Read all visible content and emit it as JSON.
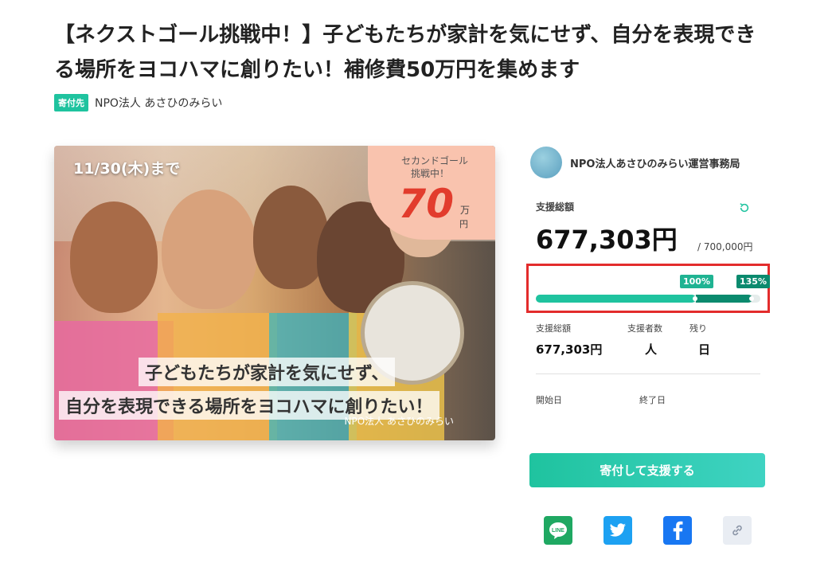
{
  "project": {
    "title": "【ネクストゴール挑戦中！】子どもたちが家計を気にせず、自分を表現できる場所をヨコハマに創りたい！補修費50万円を集めます",
    "recipient_tag": "寄付先",
    "recipient_name": "NPO法人 あさひのみらい"
  },
  "hero": {
    "deadline": "11/30(木)まで",
    "badge_line1": "セカンドゴール",
    "badge_line2": "挑戦中！",
    "badge_number": "70",
    "badge_unit1": "万",
    "badge_unit2": "円",
    "caption_line1": "子どもたちが家計を気にせず、",
    "caption_line2": "自分を表現できる場所をヨコハマに創りたい！",
    "org": "NPO法人 あさひのみらい"
  },
  "sidebar": {
    "org_name": "NPO法人あさひのみらい運営事務局",
    "total_label": "支援総額",
    "total_amount": "677,303円",
    "goal_amount": "/ 700,000円",
    "progress": {
      "first_goal_percent": 100,
      "current_percent": 135,
      "first_label": "100%",
      "current_label": "135%"
    },
    "stats": [
      {
        "label": "支援総額",
        "value": "677,303円"
      },
      {
        "label": "支援者数",
        "value": "人"
      },
      {
        "label": "残り",
        "value": "日"
      }
    ],
    "start_label": "開始日",
    "end_label": "終了日",
    "donate_button": "寄付して支援する"
  },
  "share": [
    {
      "name": "line",
      "label": "LINE"
    },
    {
      "name": "twitter",
      "label": ""
    },
    {
      "name": "facebook",
      "label": ""
    },
    {
      "name": "copy-link",
      "label": ""
    }
  ],
  "colors": {
    "accent": "#1fc39f",
    "accent_dark": "#0b8a6e",
    "highlight_border": "#e32c2c"
  }
}
